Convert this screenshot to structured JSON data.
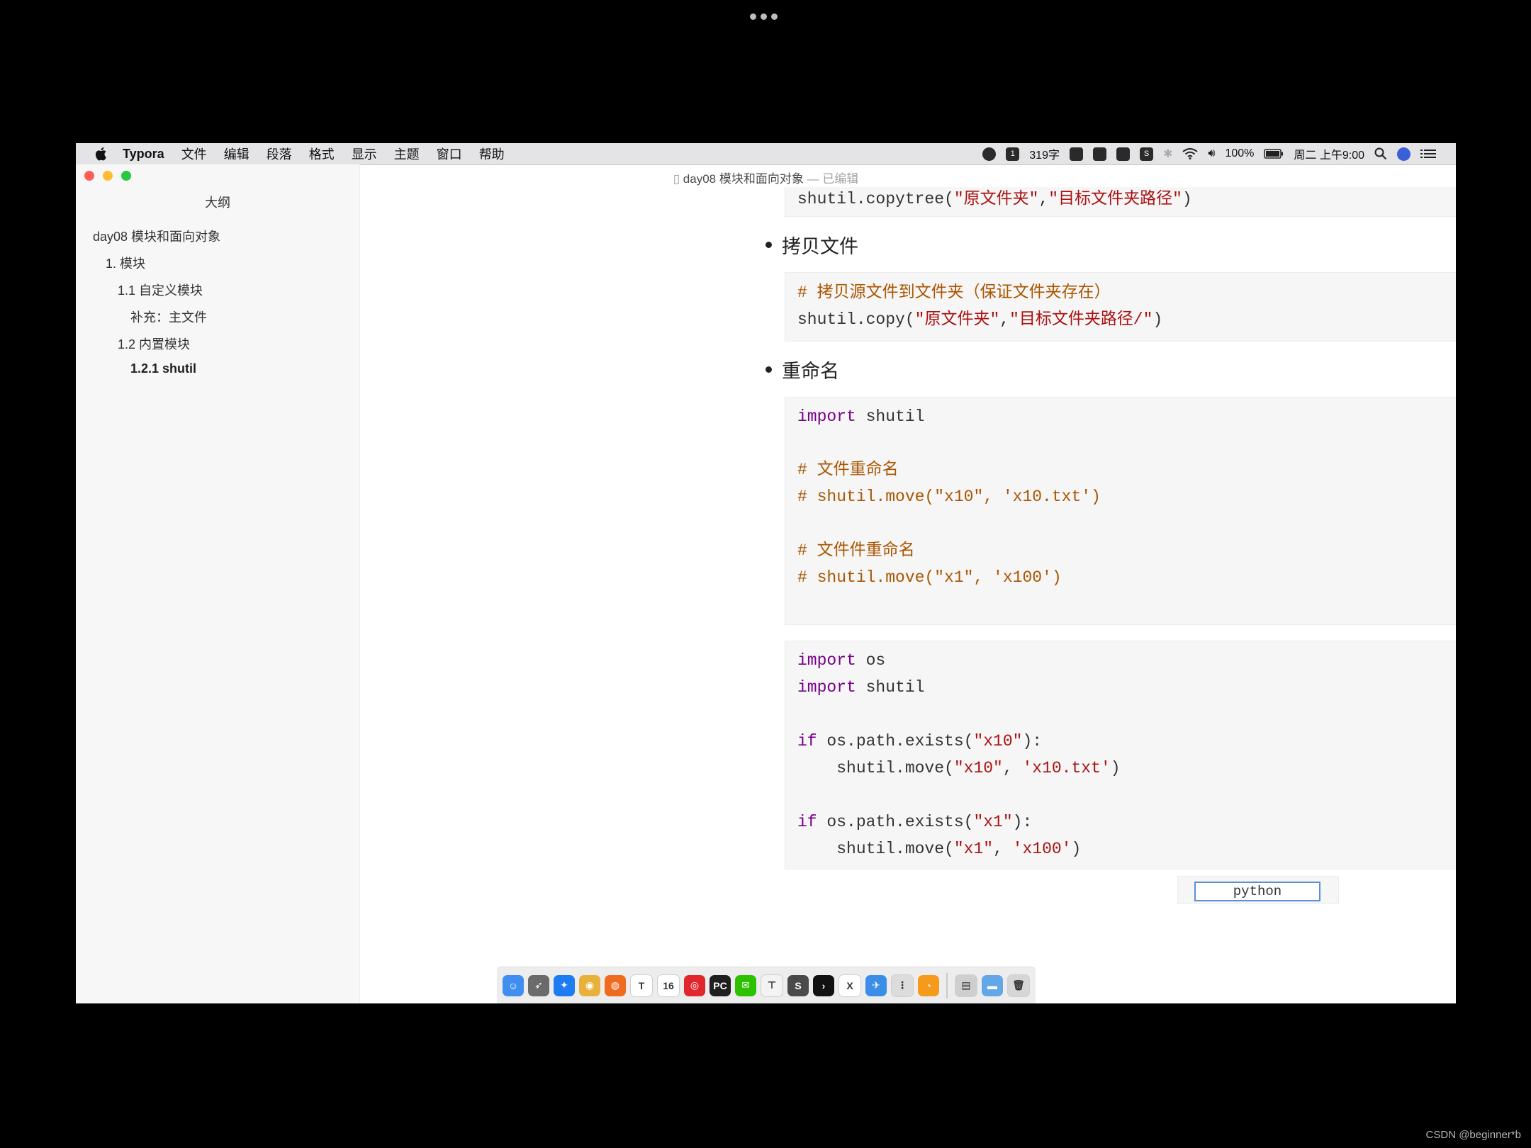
{
  "menubar": {
    "app": "Typora",
    "items": [
      "文件",
      "编辑",
      "段落",
      "格式",
      "显示",
      "主题",
      "窗口",
      "帮助"
    ],
    "status": {
      "word_count": "319字",
      "battery": "100%",
      "datetime": "周二 上午9:00"
    }
  },
  "window": {
    "title": "day08 模块和面向对象",
    "suffix": "— 已编辑"
  },
  "sidebar": {
    "title": "大纲",
    "items": [
      {
        "label": "day08 模块和面向对象"
      },
      {
        "label": "1. 模块"
      },
      {
        "label": "1.1 自定义模块"
      },
      {
        "label": "补充：主文件"
      },
      {
        "label": "1.2 内置模块"
      },
      {
        "label": "1.2.1 shutil"
      }
    ]
  },
  "editor": {
    "block0": {
      "fn": "shutil.copytree(",
      "a1": "\"原文件夹\"",
      "sep": ",",
      "a2": "\"目标文件夹路径\"",
      "end": ")"
    },
    "bullet1": "拷贝文件",
    "block1": {
      "comment": "# 拷贝源文件到文件夹（保证文件夹存在）",
      "fn": "shutil.copy(",
      "a1": "\"原文件夹\"",
      "sep": ",",
      "a2": "\"目标文件夹路径/\"",
      "end": ")"
    },
    "bullet2": "重命名",
    "block2": {
      "import_kw": "import",
      "import_mod": " shutil",
      "c1": "# 文件重命名",
      "c2": "# shutil.move(\"x10\", 'x10.txt')",
      "c3": "# 文件件重命名",
      "c4": "# shutil.move(\"x1\", 'x100')"
    },
    "block3": {
      "l1_kw": "import",
      "l1_mod": " os",
      "l2_kw": "import",
      "l2_mod": " shutil",
      "l3_kw": "if",
      "l3_a": " os.path.exists(",
      "l3_s": "\"x10\"",
      "l3_b": "):",
      "l4_a": "    shutil.move(",
      "l4_s1": "\"x10\"",
      "l4_sep": ", ",
      "l4_s2": "'x10.txt'",
      "l4_b": ")",
      "l5_kw": "if",
      "l5_a": " os.path.exists(",
      "l5_s": "\"x1\"",
      "l5_b": "):",
      "l6_a": "    shutil.move(",
      "l6_s1": "\"x1\"",
      "l6_sep": ", ",
      "l6_s2": "'x100'",
      "l6_b": ")"
    },
    "language": "python"
  },
  "dock": {
    "apps": [
      {
        "icon": "finder-icon",
        "color": "#3f8ef0",
        "glyph": "☺"
      },
      {
        "icon": "launchpad-icon",
        "color": "#6b6b6b",
        "glyph": "➶"
      },
      {
        "icon": "safari-icon",
        "color": "#1d7cf2",
        "glyph": "✦"
      },
      {
        "icon": "chrome-icon",
        "color": "#e8b23a",
        "glyph": "◉"
      },
      {
        "icon": "firefox-icon",
        "color": "#ef6b1f",
        "glyph": "◍"
      },
      {
        "icon": "typora-icon",
        "color": "#ffffff",
        "glyph": "T"
      },
      {
        "icon": "calendar-icon",
        "color": "#ffffff",
        "glyph": "16"
      },
      {
        "icon": "netease-music-icon",
        "color": "#e1262d",
        "glyph": "◎"
      },
      {
        "icon": "pycharm-icon",
        "color": "#1f1f1f",
        "glyph": "PC"
      },
      {
        "icon": "wechat-icon",
        "color": "#2dc100",
        "glyph": "✉"
      },
      {
        "icon": "keynote-icon",
        "color": "#f3f3f3",
        "glyph": "⊤"
      },
      {
        "icon": "sublime-icon",
        "color": "#4a4a4a",
        "glyph": "S"
      },
      {
        "icon": "terminal-icon",
        "color": "#111111",
        "glyph": "›"
      },
      {
        "icon": "excel-icon",
        "color": "#ffffff",
        "glyph": "X"
      },
      {
        "icon": "bird-app-icon",
        "color": "#3b8ee8",
        "glyph": "✈"
      },
      {
        "icon": "small-app-icon",
        "color": "#dcdcdc",
        "glyph": "⋮"
      },
      {
        "icon": "orange-app-icon",
        "color": "#f59a1b",
        "glyph": "◔"
      }
    ],
    "right": [
      {
        "icon": "documents-stack-icon",
        "color": "#cfcfcf",
        "glyph": "▤"
      },
      {
        "icon": "folder-icon",
        "color": "#63a7e6",
        "glyph": "▬"
      },
      {
        "icon": "trash-icon",
        "color": "#d6d6d6",
        "glyph": "🗑"
      }
    ]
  },
  "watermark": "CSDN @beginner*b"
}
